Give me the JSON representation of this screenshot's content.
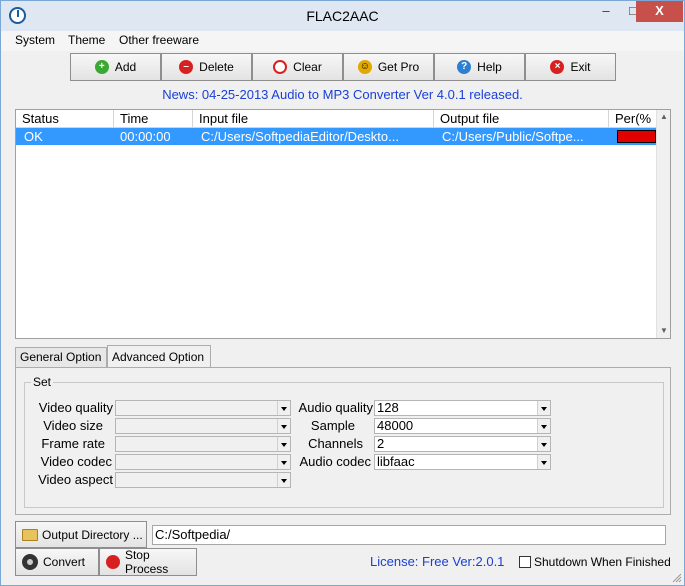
{
  "window": {
    "title": "FLAC2AAC",
    "minimize_glyph": "–",
    "maximize_glyph": "□",
    "close_glyph": "X"
  },
  "menu": {
    "items": [
      "System",
      "Theme",
      "Other freeware"
    ]
  },
  "toolbar": {
    "buttons": [
      {
        "label": "Add",
        "icon": "add-icon",
        "color": "#3aa832"
      },
      {
        "label": "Delete",
        "icon": "delete-icon",
        "color": "#d82020"
      },
      {
        "label": "Clear",
        "icon": "clear-icon",
        "color": "#d82020"
      },
      {
        "label": "Get Pro",
        "icon": "smiley-icon",
        "color": "#e0a800"
      },
      {
        "label": "Help",
        "icon": "help-icon",
        "color": "#2d7fd1"
      },
      {
        "label": "Exit",
        "icon": "exit-icon",
        "color": "#d82020"
      }
    ]
  },
  "news": "News: 04-25-2013 Audio to MP3 Converter Ver 4.0.1 released.",
  "list": {
    "columns": [
      "Status",
      "Time",
      "Input file",
      "Output file",
      "Per(%"
    ],
    "rows": [
      {
        "status": "OK",
        "time": "00:00:00",
        "input": "C:/Users/SoftpediaEditor/Deskto...",
        "output": "C:/Users/Public/Softpe...",
        "percent": 1.0
      }
    ]
  },
  "tabs": [
    "General Option",
    "Advanced Option"
  ],
  "active_tab": "Advanced Option",
  "settings": {
    "group_label": "Set",
    "left": [
      {
        "label": "Video quality",
        "value": ""
      },
      {
        "label": "Video size",
        "value": ""
      },
      {
        "label": "Frame rate",
        "value": ""
      },
      {
        "label": "Video codec",
        "value": ""
      },
      {
        "label": "Video aspect",
        "value": ""
      }
    ],
    "right": [
      {
        "label": "Audio quality",
        "value": "128"
      },
      {
        "label": "Sample",
        "value": "48000"
      },
      {
        "label": "Channels",
        "value": "2"
      },
      {
        "label": "Audio codec",
        "value": "libfaac"
      }
    ]
  },
  "output": {
    "button_label": "Output Directory ...",
    "path": "C:/Softpedia/"
  },
  "actions": {
    "convert": "Convert",
    "stop": "Stop Process"
  },
  "license": "License: Free Ver:2.0.1",
  "shutdown_label": "Shutdown When Finished",
  "colors": {
    "selection": "#3399ff",
    "news": "#1a3fd6",
    "progress": "#e00000"
  }
}
